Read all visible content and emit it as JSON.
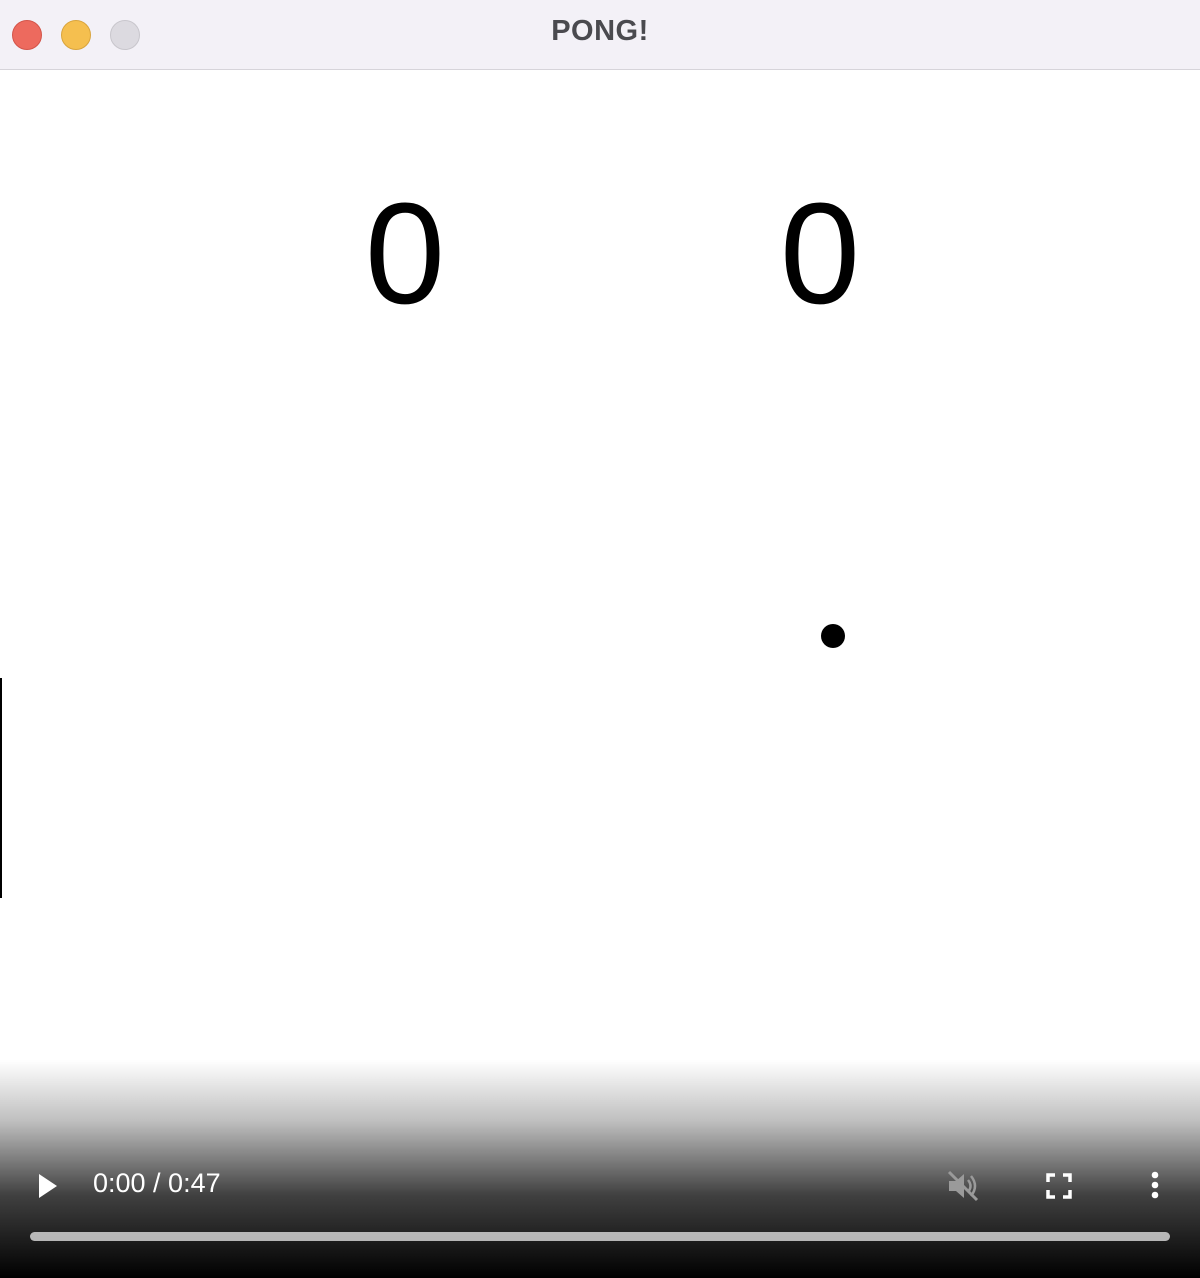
{
  "window": {
    "title": "PONG!"
  },
  "game": {
    "score_left": "0",
    "score_right": "0"
  },
  "video": {
    "time_display": "0:00 / 0:47",
    "progress": 0,
    "muted": true,
    "play_icon": "play-icon",
    "mute_icon": "speaker-muted-icon",
    "fullscreen_icon": "fullscreen-icon",
    "more_icon": "more-vertical-icon"
  },
  "colors": {
    "close": "#ed6a5e",
    "minimize": "#f5bf4f",
    "zoom": "#dcdae0",
    "titlebar": "#f3f1f7",
    "ball": "#000000"
  }
}
